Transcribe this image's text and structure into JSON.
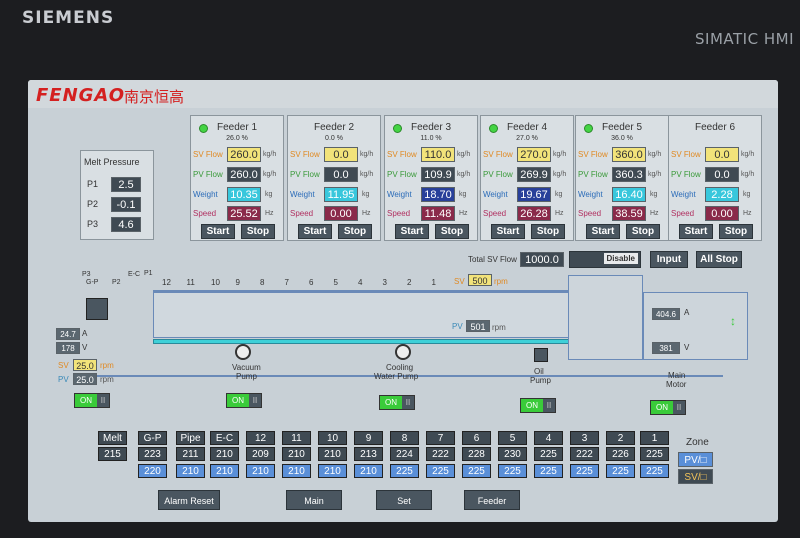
{
  "bezel": {
    "brand": "SIEMENS",
    "model": "SIMATIC HMI"
  },
  "header": {
    "logo": "FENGAO",
    "logo_cn": "南京恒高"
  },
  "melt_pressure": {
    "title": "Melt Pressure",
    "rows": [
      {
        "label": "P1",
        "value": "2.5"
      },
      {
        "label": "P2",
        "value": "-0.1"
      },
      {
        "label": "P3",
        "value": "4.6"
      }
    ]
  },
  "feeder_labels": {
    "sv": "SV Flow",
    "pv": "PV Flow",
    "weight": "Weight",
    "speed": "Speed",
    "unit_flow": "kg/h",
    "unit_weight": "kg",
    "unit_speed": "Hz",
    "start": "Start",
    "stop": "Stop"
  },
  "feeders": [
    {
      "name": "Feeder 1",
      "pct": "26.0 %",
      "sv": "260.0",
      "pv": "260.0",
      "weight": "10.35",
      "speed": "25.52",
      "running": true
    },
    {
      "name": "Feeder 2",
      "pct": "0.0 %",
      "sv": "0.0",
      "pv": "0.0",
      "weight": "11.95",
      "speed": "0.00",
      "running": false
    },
    {
      "name": "Feeder 3",
      "pct": "11.0 %",
      "sv": "110.0",
      "pv": "109.9",
      "weight": "18.70",
      "speed": "11.48",
      "running": true
    },
    {
      "name": "Feeder 4",
      "pct": "27.0 %",
      "sv": "270.0",
      "pv": "269.9",
      "weight": "19.67",
      "speed": "26.28",
      "running": true
    },
    {
      "name": "Feeder 5",
      "pct": "36.0 %",
      "sv": "360.0",
      "pv": "360.3",
      "weight": "16.40",
      "speed": "38.59",
      "running": true
    },
    {
      "name": "Feeder 6",
      "pct": "",
      "sv": "0.0",
      "pv": "0.0",
      "weight": "2.28",
      "speed": "0.00",
      "running": false
    }
  ],
  "total": {
    "label": "Total SV Flow",
    "value": "1000.0",
    "disable": "Disable",
    "input": "Input",
    "all_stop": "All Stop"
  },
  "process": {
    "zone_numbers": [
      "12",
      "11",
      "10",
      "9",
      "8",
      "7",
      "6",
      "5",
      "4",
      "3",
      "2",
      "1"
    ],
    "top_labels": {
      "p3": "P3",
      "e_c": "E-C",
      "p1": "P1",
      "g_p": "G-P",
      "p2": "P2"
    },
    "screw_sv_label": "SV",
    "screw_sv": "500",
    "screw_unit": "rpm",
    "screw_pv_label": "PV",
    "screw_pv": "501",
    "screw_pv_unit": "rpm",
    "melt_pump": {
      "val1": "24.7",
      "val2": "178",
      "unit1": "A",
      "unit2": "V",
      "sv_label": "SV",
      "sv": "25.0",
      "pv_label": "PV",
      "pv": "25.0",
      "unit": "rpm"
    },
    "main_motor": {
      "current": "404.6",
      "voltage": "381",
      "unit_a": "A",
      "unit_v": "V",
      "label_line1": "Main",
      "label_line2": "Motor"
    },
    "vacuum": {
      "line1": "Vacuum",
      "line2": "Pump"
    },
    "cooling": {
      "line1": "Cooling",
      "line2": "Water Pump"
    },
    "oil": {
      "line1": "Oil",
      "line2": "Pump"
    },
    "toggle_on": "ON",
    "toggle_off": "II"
  },
  "zones": {
    "headers": [
      "Melt",
      "G-P",
      "Pipe",
      "E-C",
      "12",
      "11",
      "10",
      "9",
      "8",
      "7",
      "6",
      "5",
      "4",
      "3",
      "2",
      "1"
    ],
    "sv": [
      "215",
      "223",
      "211",
      "210",
      "209",
      "210",
      "210",
      "213",
      "224",
      "222",
      "228",
      "230",
      "225",
      "222",
      "226",
      "225"
    ],
    "pv": [
      "",
      "220",
      "210",
      "210",
      "210",
      "210",
      "210",
      "210",
      "225",
      "225",
      "225",
      "225",
      "225",
      "225",
      "225",
      "225"
    ],
    "zone_label": "Zone",
    "pv_label": "PV/□",
    "sv_label": "SV/□"
  },
  "footer": {
    "alarm_reset": "Alarm Reset",
    "main": "Main",
    "set": "Set",
    "feeder": "Feeder"
  }
}
